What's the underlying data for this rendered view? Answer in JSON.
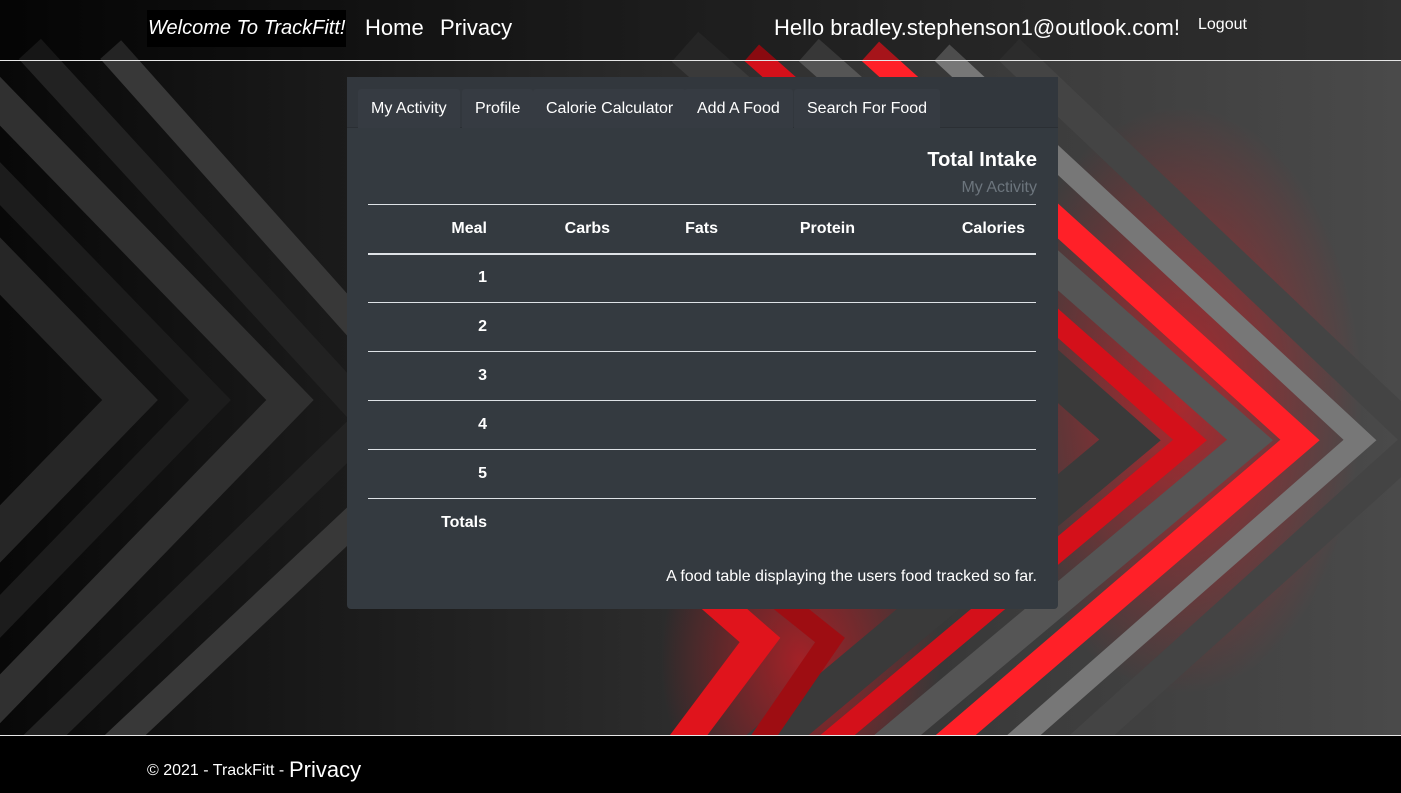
{
  "header": {
    "brand": "Welcome To TrackFitt!",
    "nav": [
      "Home",
      "Privacy"
    ],
    "greeting": "Hello bradley.stephenson1@outlook.com!",
    "logout": "Logout"
  },
  "tabs": [
    "My Activity",
    "Profile",
    "Calorie Calculator",
    "Add A Food",
    "Search For Food"
  ],
  "card": {
    "title": "Total Intake",
    "subtitle": "My Activity",
    "caption": "A food table displaying the users food tracked so far."
  },
  "table": {
    "columns": [
      "Meal",
      "Carbs",
      "Fats",
      "Protein",
      "Calories"
    ],
    "rows": [
      "1",
      "2",
      "3",
      "4",
      "5",
      "Totals"
    ]
  },
  "footer": {
    "copyright": "© 2021 - TrackFitt -",
    "link": "Privacy"
  },
  "colors": {
    "card_bg": "#343a40",
    "accent_red": "#ff1a1a",
    "muted_text": "#6c757d"
  }
}
